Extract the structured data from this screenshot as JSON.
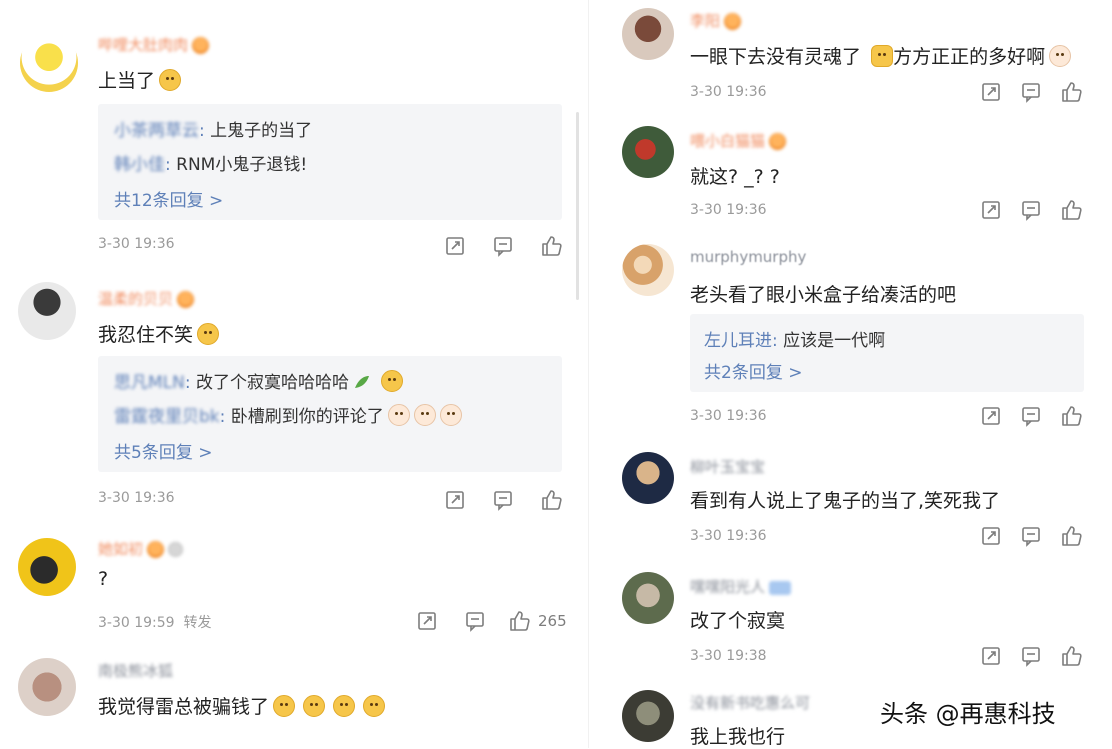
{
  "left": {
    "comments": [
      {
        "username": "哔哩大肚肉肉",
        "text": "上当了",
        "replies": [
          {
            "name": "小茶两草云",
            "text": "上鬼子的当了"
          },
          {
            "name": "韩小佳",
            "text": "RNM小鬼子退钱!"
          }
        ],
        "more": "共12条回复 >",
        "time": "3-30 19:36"
      },
      {
        "username": "温柔的贝贝",
        "text": "我忍住不笑",
        "replies": [
          {
            "name": "思凡MLN",
            "text": "改了个寂寞哈哈哈哈"
          },
          {
            "name": "雷霆夜里贝bk",
            "text": "卧槽刷到你的评论了"
          }
        ],
        "more": "共5条回复 >",
        "time": "3-30 19:36"
      },
      {
        "username": "她如初",
        "text": "?",
        "time": "3-30 19:59",
        "time_suffix": "转发",
        "like_count": "265"
      },
      {
        "username": "南极熊冰狐",
        "text": "我觉得雷总被骗钱了"
      }
    ]
  },
  "right": {
    "comments": [
      {
        "username": "李阳",
        "text_a": "一眼下去没有灵魂了",
        "text_b": "方方正正的多好啊",
        "time": "3-30 19:36"
      },
      {
        "username": "喂小白猫猫",
        "text": "就这?  _? ?",
        "time": "3-30 19:36"
      },
      {
        "username": "murphymurphy",
        "text": "老头看了眼小米盒子给凑活的吧",
        "replies": [
          {
            "name": "左儿耳进",
            "text": "应该是一代啊"
          }
        ],
        "more": "共2条回复 >",
        "time": "3-30 19:36"
      },
      {
        "username": "柳叶玉宝宝",
        "text": "看到有人说上了鬼子的当了,笑死我了",
        "time": "3-30 19:36"
      },
      {
        "username": "嘿嘿阳光人",
        "text": "改了个寂寞",
        "time": "3-30 19:38"
      },
      {
        "username": "没有新书吃惠么可",
        "text": "我上我也行"
      }
    ]
  },
  "watermark": "头条 @再惠科技",
  "colors": {
    "username": "#f08a5d",
    "reply_name": "#5e80b8",
    "reply_bg": "#f4f5f7",
    "meta": "#9a9a9a"
  },
  "icons": [
    "share-icon",
    "comment-icon",
    "like-icon"
  ]
}
